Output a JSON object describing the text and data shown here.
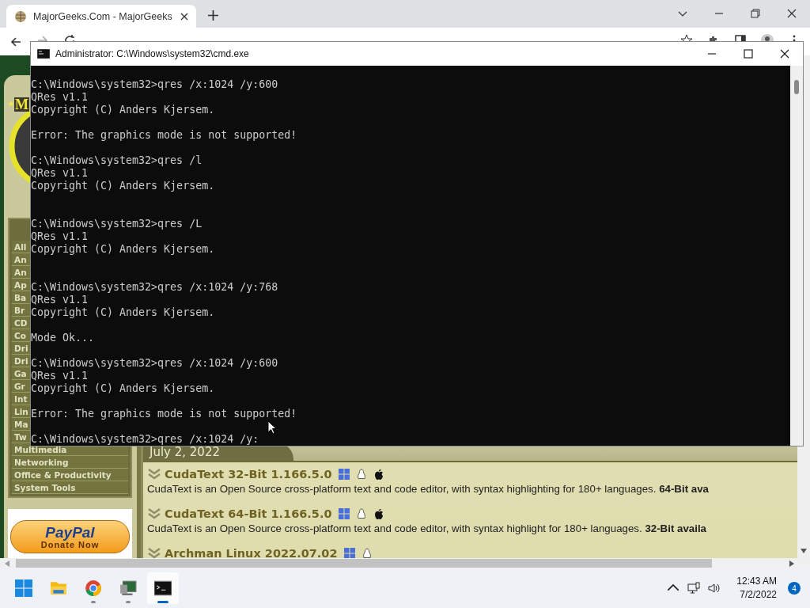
{
  "browser": {
    "tabs": [
      {
        "title": "MajorGeeks.Com - MajorGeeks",
        "selected": true
      }
    ]
  },
  "sidebar": {
    "logo_text": "M",
    "categories": [
      "All",
      "An",
      "An",
      "Ap",
      "Ba",
      "Br",
      "CD",
      "Co",
      "Dri",
      "Dri",
      "Ga",
      "Gr",
      "Int",
      "Lin",
      "Ma",
      "Tw",
      "Multimedia",
      "Networking",
      "Office & Productivity",
      "System Tools"
    ],
    "donate": {
      "brand": "PayPal",
      "label": "Donate Now"
    }
  },
  "content": {
    "date": "July 2, 2022",
    "articles": [
      {
        "title": "CudaText 32-Bit 1.166.5.0",
        "platforms": [
          {
            "kind": "windows"
          },
          {
            "kind": "linux"
          },
          {
            "kind": "apple"
          }
        ],
        "description": "CudaText is an Open Source cross-platform text and code editor, with syntax highlighting for 180+ languages. **64-Bit ava**"
      },
      {
        "title": "CudaText 64-Bit 1.166.5.0",
        "platforms": [
          {
            "kind": "windows"
          },
          {
            "kind": "linux"
          },
          {
            "kind": "apple"
          }
        ],
        "description": "CudaText is an Open Source cross-platform text and code editor, with syntax highlight for 180+ languages. **32-Bit availa**"
      },
      {
        "title": "Archman Linux 2022.07.02",
        "platforms": [
          {
            "kind": "windows"
          },
          {
            "kind": "linux"
          }
        ]
      }
    ]
  },
  "terminal": {
    "title": "Administrator: C:\\Windows\\system32\\cmd.exe",
    "lines": [
      {
        "kind": "text",
        "text": "C:\\Windows\\system32>qres /x:1024 /y:600"
      },
      {
        "kind": "text",
        "text": "QRes v1.1"
      },
      {
        "kind": "text",
        "text": "Copyright (C) Anders Kjersem."
      },
      {
        "kind": "blank"
      },
      {
        "kind": "text",
        "text": "Error: The graphics mode is not supported!"
      },
      {
        "kind": "blank"
      },
      {
        "kind": "text",
        "text": "C:\\Windows\\system32>qres /l"
      },
      {
        "kind": "text",
        "text": "QRes v1.1"
      },
      {
        "kind": "text",
        "text": "Copyright (C) Anders Kjersem."
      },
      {
        "kind": "blank"
      },
      {
        "kind": "blank"
      },
      {
        "kind": "text",
        "text": "C:\\Windows\\system32>qres /L"
      },
      {
        "kind": "text",
        "text": "QRes v1.1"
      },
      {
        "kind": "text",
        "text": "Copyright (C) Anders Kjersem."
      },
      {
        "kind": "blank"
      },
      {
        "kind": "blank"
      },
      {
        "kind": "text",
        "text": "C:\\Windows\\system32>qres /x:1024 /y:768"
      },
      {
        "kind": "text",
        "text": "QRes v1.1"
      },
      {
        "kind": "text",
        "text": "Copyright (C) Anders Kjersem."
      },
      {
        "kind": "blank"
      },
      {
        "kind": "text",
        "text": "Mode Ok..."
      },
      {
        "kind": "blank"
      },
      {
        "kind": "text",
        "text": "C:\\Windows\\system32>qres /x:1024 /y:600"
      },
      {
        "kind": "text",
        "text": "QRes v1.1"
      },
      {
        "kind": "text",
        "text": "Copyright (C) Anders Kjersem."
      },
      {
        "kind": "blank"
      },
      {
        "kind": "text",
        "text": "Error: The graphics mode is not supported!"
      },
      {
        "kind": "blank"
      },
      {
        "kind": "text",
        "text": "C:\\Windows\\system32>qres /x:1024 /y:"
      }
    ]
  },
  "taskbar": {
    "apps": [
      {
        "kind": "start",
        "running": false,
        "selected": false
      },
      {
        "kind": "folder",
        "running": false,
        "selected": false
      },
      {
        "kind": "browser",
        "running": true,
        "selected": false
      },
      {
        "kind": "monitor",
        "running": true,
        "selected": false
      },
      {
        "kind": "terminal",
        "running": true,
        "selected": true
      }
    ],
    "time": "12:43 AM",
    "date": "7/2/2022",
    "notifications": "4"
  }
}
